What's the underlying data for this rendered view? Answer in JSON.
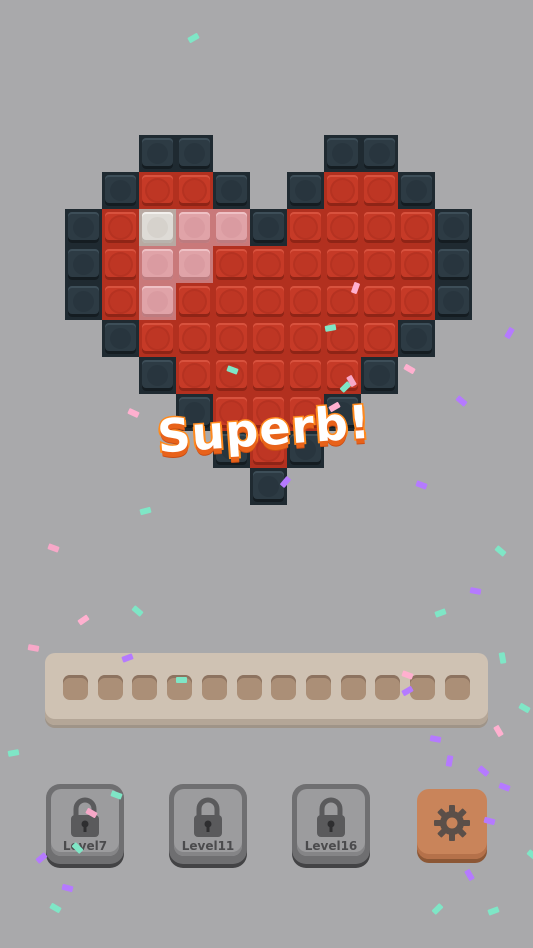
{
  "title": "Superb!",
  "colors": {
    "background": "#a9a9ab",
    "red": "#c63a27",
    "dark": "#2d3b44",
    "pink": "#e0a3a8",
    "white": "#dedbd6",
    "title_orange": "#ff8a1d"
  },
  "board": {
    "picture": "heart",
    "rows": [
      "..DD...DD..",
      ".DRRD.DRRD.",
      "DRWPPDRRRRD",
      "DRPPRRRRRRD",
      "DRPRRRRRRRD",
      ".DRRRRRRRD.",
      "..DRRRRRD..",
      "...DRRRD...",
      "....DRD....",
      ".....D....."
    ],
    "legend": {
      "D": "dark",
      "R": "red",
      "P": "pink",
      "W": "white"
    }
  },
  "tray": {
    "slots": 12,
    "filled": 0
  },
  "levels": [
    {
      "label": "Level7",
      "locked": true,
      "icon": "lock-icon"
    },
    {
      "label": "Level11",
      "locked": true,
      "icon": "lock-icon"
    },
    {
      "label": "Level16",
      "locked": true,
      "icon": "lock-icon"
    }
  ],
  "settings": {
    "icon": "gear-icon"
  },
  "confetti_colors": [
    "#b57aff",
    "#7fe6c6",
    "#ffb0cf",
    "#f7a8c8"
  ]
}
